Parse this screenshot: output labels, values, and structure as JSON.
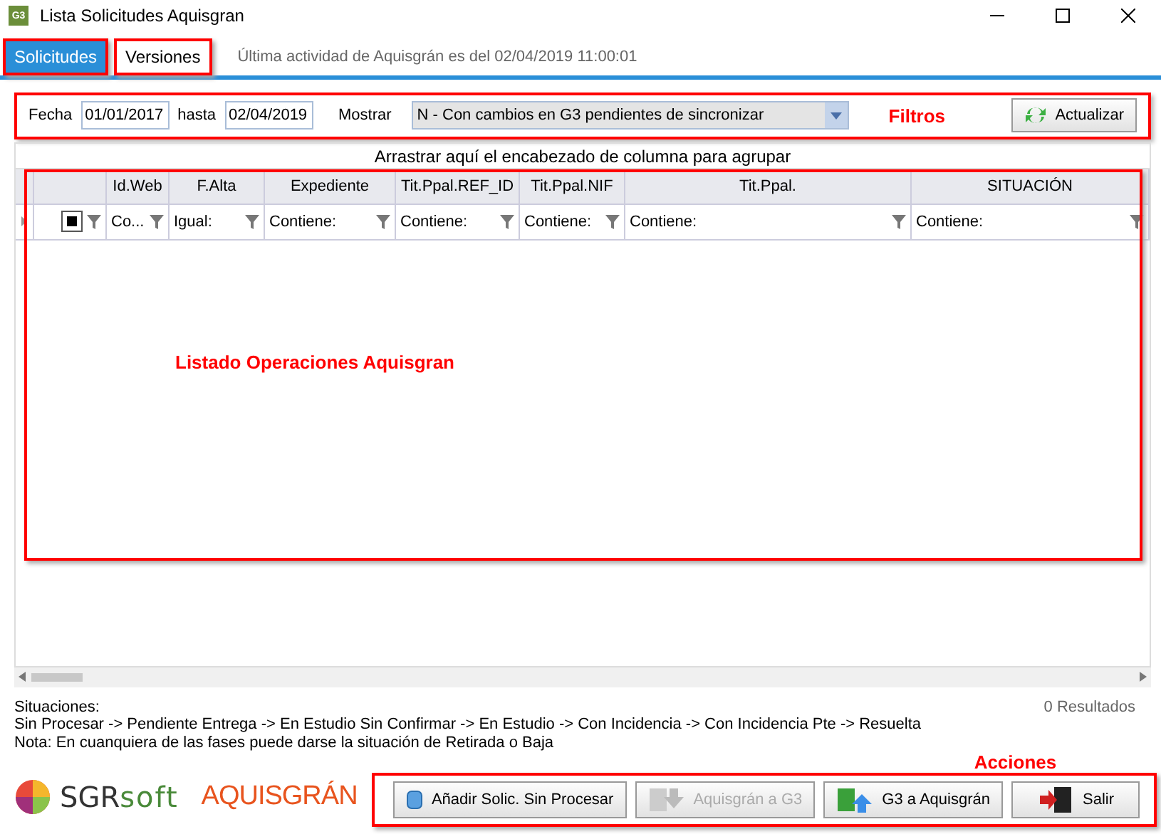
{
  "window": {
    "title": "Lista Solicitudes Aquisgran",
    "app_badge": "G3"
  },
  "tabs": [
    {
      "label": "Solicitudes",
      "selected": true,
      "highlighted": true
    },
    {
      "label": "Versiones",
      "selected": false,
      "highlighted": true
    }
  ],
  "last_activity": "Última actividad de Aquisgrán es del 02/04/2019 11:00:01",
  "filters": {
    "highlighted": true,
    "date_label": "Fecha",
    "date_from": "01/01/2017",
    "until_label": "hasta",
    "date_to": "02/04/2019",
    "show_label": "Mostrar",
    "show_value": "N - Con cambios en G3 pendientes de sincronizar",
    "annotation": "Filtros",
    "refresh_button": "Actualizar"
  },
  "group_hint": "Arrastrar aquí el encabezado de columna para agrupar",
  "grid": {
    "highlighted": true,
    "annotation": "Listado Operaciones Aquisgran",
    "columns": [
      {
        "kind": "check",
        "indeterminate": true
      },
      {
        "kind": "text",
        "header": "Id.Web",
        "filter": "Co..."
      },
      {
        "kind": "text",
        "header": "F.Alta",
        "filter": "Igual:"
      },
      {
        "kind": "text",
        "header": "Expediente",
        "filter": "Contiene:"
      },
      {
        "kind": "text",
        "header": "Tit.Ppal.REF_ID",
        "filter": "Contiene:"
      },
      {
        "kind": "text",
        "header": "Tit.Ppal.NIF",
        "filter": "Contiene:"
      },
      {
        "kind": "text",
        "header": "Tit.Ppal.",
        "filter": "Contiene:"
      },
      {
        "kind": "text",
        "header": "SITUACIÓN",
        "filter": "Contiene:"
      }
    ]
  },
  "notes": [
    "Situaciones:",
    "Sin Procesar -> Pendiente Entrega -> En Estudio Sin Confirmar -> En Estudio -> Con Incidencia -> Con Incidencia Pte -> Resuelta",
    "Nota: En cuanquiera de las fases puede darse la situación de Retirada o Baja"
  ],
  "results": "0 Resultados",
  "logos": {
    "sgr_bold": "SGR",
    "sgr_light": "soft",
    "aquisgran": "AQUISGRÁN"
  },
  "actions": {
    "highlighted": true,
    "annotation": "Acciones",
    "buttons": [
      {
        "kind": "add",
        "label": "Añadir Solic. Sin Procesar",
        "disabled": false
      },
      {
        "kind": "import",
        "label": "Aquisgrán a G3",
        "disabled": true
      },
      {
        "kind": "export",
        "label": "G3 a Aquisgrán",
        "disabled": false
      },
      {
        "kind": "exit",
        "label": "Salir",
        "disabled": false
      }
    ]
  }
}
